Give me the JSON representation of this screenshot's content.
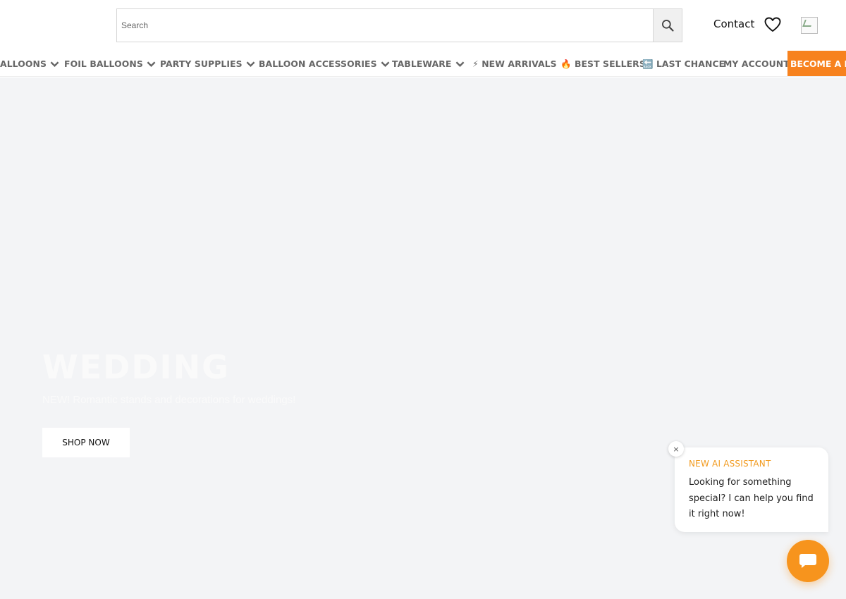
{
  "header": {
    "search": {
      "placeholder": "Search",
      "value": ""
    },
    "contact_label": "Contact",
    "icons": {
      "search": "search-icon",
      "wishlist": "heart-icon",
      "account": "broken-image-icon"
    }
  },
  "nav": {
    "items": [
      {
        "label": "ALLOONS",
        "dropdown": true
      },
      {
        "label": "FOIL BALLOONS",
        "dropdown": true
      },
      {
        "label": "PARTY SUPPLIES",
        "dropdown": true
      },
      {
        "label": "BALLOON ACCESSORIES",
        "dropdown": true
      },
      {
        "label": "TABLEWARE",
        "dropdown": true
      },
      {
        "label": "⚡ NEW ARRIVALS",
        "dropdown": false
      },
      {
        "label": "🔥 BEST SELLERS",
        "dropdown": false
      },
      {
        "label": "🔙 LAST CHANCE",
        "dropdown": false
      },
      {
        "label": "MY ACCOUNT",
        "dropdown": false
      }
    ],
    "cta_label": "BECOME A R",
    "cta_color": "#f7821e"
  },
  "hero": {
    "title": "WEDDING",
    "subtitle": "NEW! Romantic stands and decorations for weddings!",
    "button_label": "SHOP NOW",
    "background": "#f3f4f6"
  },
  "chat": {
    "heading": "NEW AI ASSISTANT",
    "message": "Looking for something special? I can help you find it right now!",
    "close_label": "×",
    "accent_color": "#f7941d",
    "icons": {
      "launcher": "chat-bubble-icon",
      "close": "close-icon"
    }
  }
}
